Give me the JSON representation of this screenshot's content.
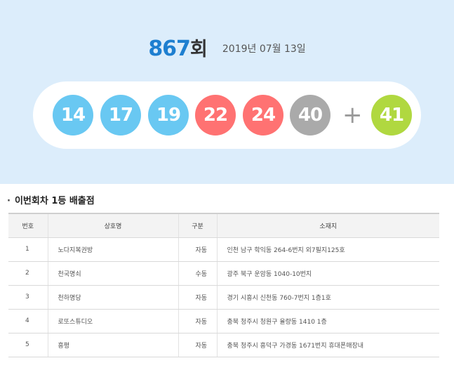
{
  "draw": {
    "round_number": "867",
    "round_suffix": "회",
    "date": "2019년 07월 13일"
  },
  "balls": [
    {
      "number": "14",
      "color": "#69c8f2"
    },
    {
      "number": "17",
      "color": "#69c8f2"
    },
    {
      "number": "19",
      "color": "#69c8f2"
    },
    {
      "number": "22",
      "color": "#ff7272"
    },
    {
      "number": "24",
      "color": "#ff7272"
    },
    {
      "number": "40",
      "color": "#aaaaaa"
    }
  ],
  "plus_symbol": "+",
  "bonus_ball": {
    "number": "41",
    "color": "#b0d840"
  },
  "section": {
    "bullet": "·",
    "title": "이번회차 1등 배출점"
  },
  "table": {
    "headers": [
      "번호",
      "상호명",
      "구분",
      "소재지"
    ],
    "rows": [
      [
        "1",
        "노다지복권방",
        "자동",
        "인천 남구 학익동 264-6번지 외7필지125호"
      ],
      [
        "2",
        "천국명쇠",
        "수동",
        "광주 북구 운암동 1040-10번지"
      ],
      [
        "3",
        "천하명당",
        "자동",
        "경기 시흥시 신천동 760-7번지 1층1호"
      ],
      [
        "4",
        "로또스튜디오",
        "자동",
        "충북 청주시 청원구 율량동 1410 1층"
      ],
      [
        "5",
        "흥평",
        "자동",
        "충북 청주시 흥덕구 가경동 1671번지 휴대폰매장내"
      ]
    ]
  }
}
